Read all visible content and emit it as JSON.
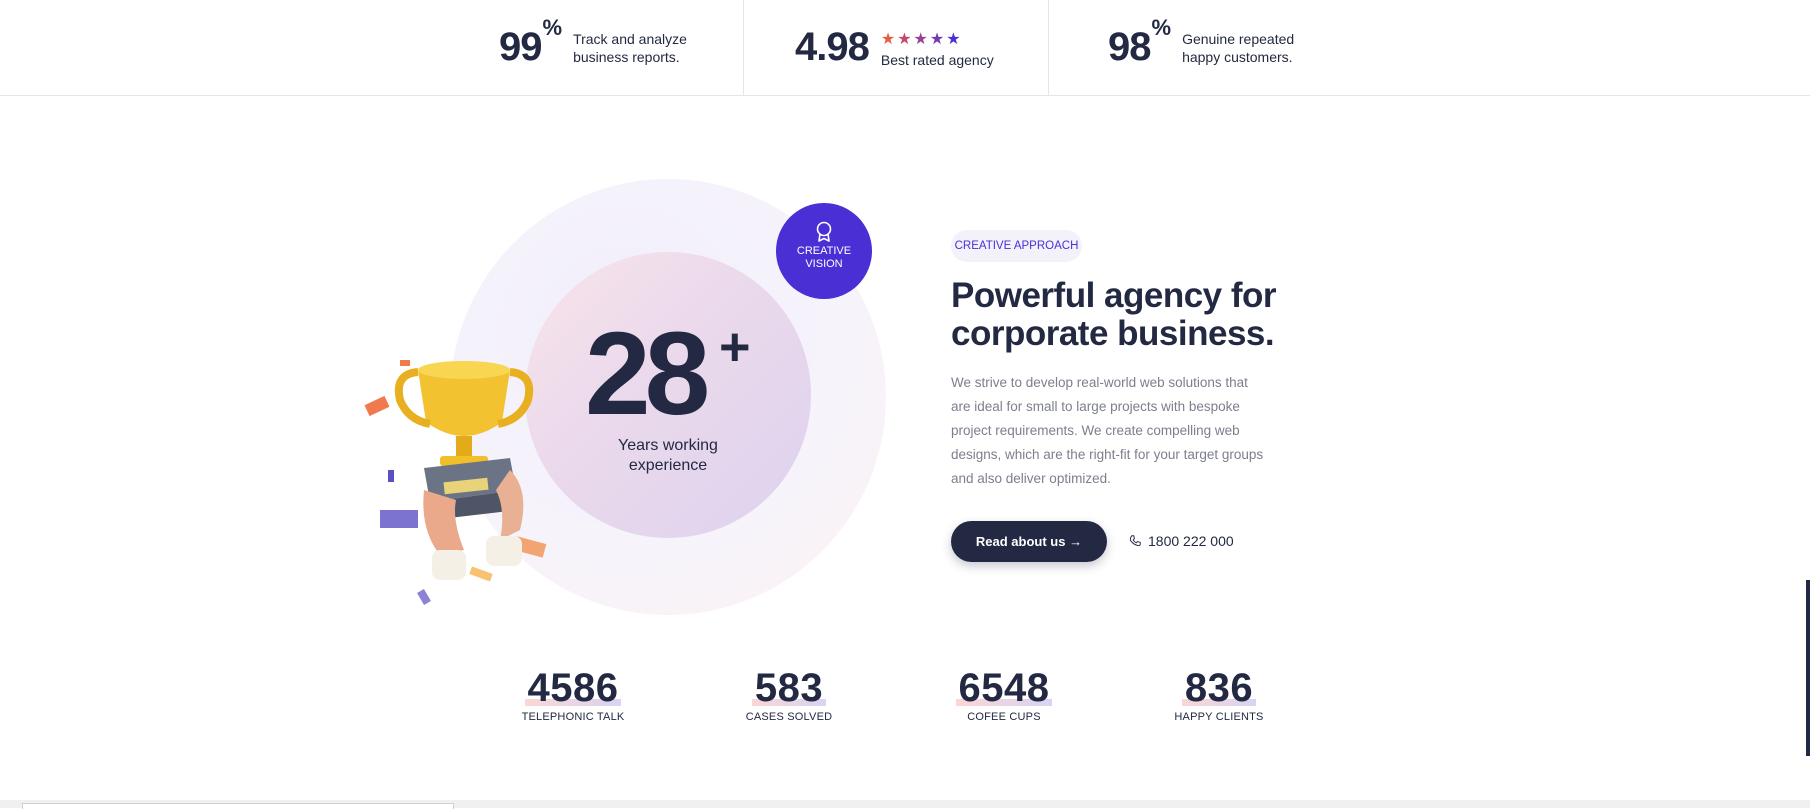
{
  "stats_bar": [
    {
      "number": "99",
      "suffix": "%",
      "text_line1": "Track and analyze",
      "text_line2": "business reports."
    },
    {
      "number": "4.98",
      "rating_text": "Best rated agency"
    },
    {
      "number": "98",
      "suffix": "%",
      "text_line1": "Genuine repeated",
      "text_line2": "happy customers."
    }
  ],
  "rating": {
    "stars": 5,
    "star_colors": [
      "#e2603f",
      "#c4496a",
      "#9b3f92",
      "#6f3bb4",
      "#4a2fd4"
    ]
  },
  "experience": {
    "number": "28",
    "plus": "+",
    "label_line1": "Years working",
    "label_line2": "experience"
  },
  "badge": {
    "line1": "CREATIVE",
    "line2": "VISION",
    "color": "#4a2fd4"
  },
  "content": {
    "tag": "CREATIVE APPROACH",
    "heading_line1": "Powerful agency for",
    "heading_line2": "corporate business.",
    "paragraph": "We strive to develop real-world web solutions that are ideal for small to large projects with bespoke project requirements. We create compelling web designs, which are the right-fit for your target groups and also deliver optimized.",
    "button_label": "Read about us →",
    "phone": "1800 222 000"
  },
  "counters": [
    {
      "value": "4586",
      "label": "TELEPHONIC TALK"
    },
    {
      "value": "583",
      "label": "CASES SOLVED"
    },
    {
      "value": "6548",
      "label": "COFEE CUPS"
    },
    {
      "value": "836",
      "label": "HAPPY CLIENTS"
    }
  ],
  "colors": {
    "primary": "#232942",
    "accent": "#4a2fd4",
    "muted": "#7c7f8d"
  }
}
